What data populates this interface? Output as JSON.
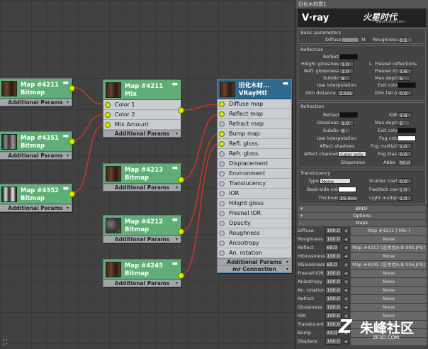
{
  "watermark": {
    "top": "火星时代",
    "url": "www.hxsd.com",
    "brand": "朱峰社区",
    "brand_site": "ZF3D.COM"
  },
  "nodes": {
    "b4211": {
      "name": "Map #4211",
      "type": "Bitmap",
      "params": "Additional Params"
    },
    "b4351": {
      "name": "Map #4351",
      "type": "Bitmap",
      "params": "Additional Params"
    },
    "b4352": {
      "name": "Map #4352",
      "type": "Bitmap",
      "params": "Additional Params"
    },
    "mix": {
      "name": "Map #4211",
      "type": "Mix",
      "ports": [
        "Color 1",
        "Color 2",
        "Mix Amount"
      ],
      "params": "Additional Params"
    },
    "b4213": {
      "name": "Map #4213",
      "type": "Bitmap",
      "params": "Additional Params"
    },
    "b4212": {
      "name": "Map #4212",
      "type": "Bitmap",
      "params": "Additional Params"
    },
    "b4245": {
      "name": "Map #4245",
      "type": "Bitmap",
      "params": "Additional Params"
    },
    "vray": {
      "name": "旧化木材...",
      "type": "VRayMtl",
      "ports": [
        "Diffuse map",
        "Reflect map",
        "Refract map",
        "Bump map",
        "Refl. gloss.",
        "Refr. gloss.",
        "Displacement",
        "Environment",
        "Translucency",
        "IOR",
        "Hilight gloss",
        "Fresnel IOR",
        "Opacity",
        "Roughness",
        "Anisotropy",
        "An. rotation"
      ],
      "params": "Additional Params",
      "conn": "mr Connection"
    }
  },
  "panel": {
    "title": "旧化木材质1",
    "banner": "V·ray",
    "basic": {
      "label": "Basic parameters",
      "diffuse": "Diffuse",
      "roughness": "Roughness",
      "roughness_val": "0.1",
      "m": "M"
    },
    "reflection": {
      "label": "Reflection",
      "reflect": "Reflect",
      "hilight": "Hilight glossiness",
      "hilight_val": "1.0",
      "fresnel": "Fresnel reflections",
      "refl_gloss": "Refl. glossiness",
      "refl_gloss_val": "1.0",
      "fresnel_ior": "Fresnel IOR",
      "fresnel_ior_val": "1.6",
      "subdivs": "Subdivs",
      "subdivs_val": "8",
      "max_depth": "Max depth",
      "max_depth_val": "5",
      "use_interp": "Use interpolation",
      "exit_color": "Exit color",
      "dim_distance": "Dim distance",
      "dim_distance_val": "2.54c",
      "dim_falloff": "Dim fall off",
      "dim_falloff_val": "0.0",
      "l": "L"
    },
    "refraction": {
      "label": "Refraction",
      "refract": "Refract",
      "ior": "IOR",
      "ior_val": "1.6",
      "glossiness": "Glossiness",
      "glossiness_val": "1.0",
      "max_depth": "Max depth",
      "max_depth_val": "5",
      "subdivs": "Subdivs",
      "subdivs_val": "8",
      "exit_color": "Exit color",
      "use_interp": "Use interpolation",
      "fog_color": "Fog color",
      "affect_shadows": "Affect shadows",
      "fog_mult": "Fog multiplier",
      "fog_mult_val": "1.0",
      "affect_channels": "Affect channels",
      "affect_channels_val": "Color only",
      "fog_bias": "Fog bias",
      "fog_bias_val": "0.0",
      "dispersion": "Dispersion",
      "abbe": "Abbe",
      "abbe_val": "50.0"
    },
    "translucency": {
      "label": "Translucency",
      "type": "Type",
      "type_val": "None",
      "scatter": "Scatter coeff",
      "scatter_val": "0.0",
      "back_side": "Back-side color",
      "fwd_bck": "Fwd/bck coeff",
      "fwd_bck_val": "1.0",
      "thickness": "Thickness",
      "thickness_val": "25.4cm",
      "light_mult": "Light multiplier",
      "light_mult_val": "1.0"
    },
    "rollouts": {
      "brdf": "BRDF",
      "options": "Options",
      "maps": "Maps",
      "plus": "+",
      "minus": "-"
    },
    "maps": [
      {
        "name": "Diffuse",
        "val": "100.0",
        "map": "Map #4211 ( Mix )"
      },
      {
        "name": "Roughness",
        "val": "100.0",
        "map": "None"
      },
      {
        "name": "Reflect",
        "val": "60.0",
        "map": "Map #4213 (旧木纹A-B-006.JPG)"
      },
      {
        "name": "HGlossiness",
        "val": "100.0",
        "map": "None"
      },
      {
        "name": "RGlossiness",
        "val": "60.0",
        "map": "Map #4245 (旧木纹A-B-006.JPG)"
      },
      {
        "name": "Fresnel IOR",
        "val": "100.0",
        "map": "None"
      },
      {
        "name": "Anisotropy",
        "val": "100.0",
        "map": "None"
      },
      {
        "name": "An. rotation",
        "val": "100.0",
        "map": "None"
      },
      {
        "name": "Refract",
        "val": "100.0",
        "map": "None"
      },
      {
        "name": "Glossiness",
        "val": "100.0",
        "map": "None"
      },
      {
        "name": "IOR",
        "val": "100.0",
        "map": "None"
      },
      {
        "name": "Translucent",
        "val": "100.0",
        "map": "None"
      },
      {
        "name": "Bump",
        "val": "44.0",
        "map": ""
      },
      {
        "name": "Displace",
        "val": "100.0",
        "map": ""
      }
    ]
  },
  "colors": {
    "accent": "#c8f000",
    "wire": "#c0392b",
    "header_green": "#5fae78",
    "header_blue": "#2f6a8e"
  }
}
